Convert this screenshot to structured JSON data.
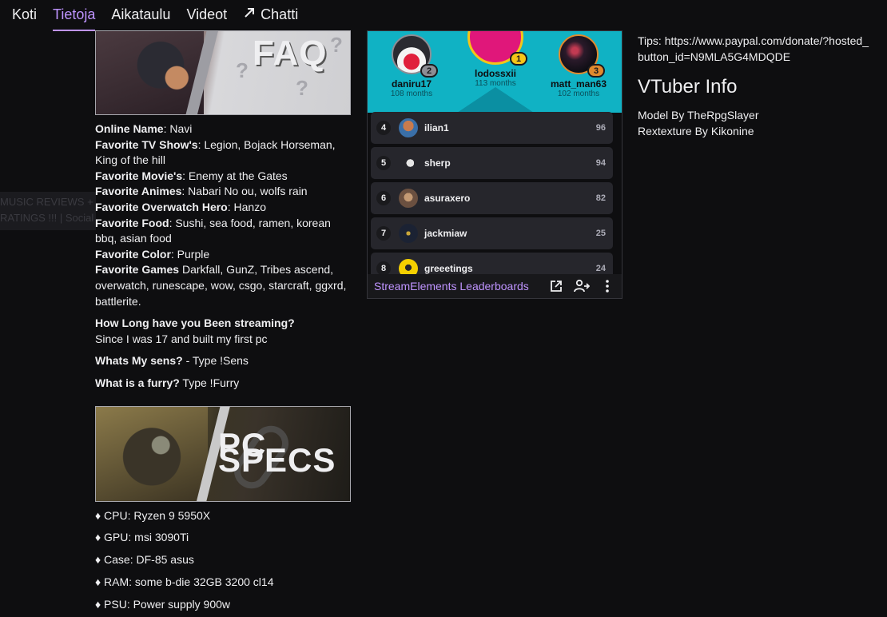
{
  "nav": {
    "tabs": [
      {
        "label": "Koti",
        "active": false
      },
      {
        "label": "Tietoja",
        "active": true
      },
      {
        "label": "Aikataulu",
        "active": false
      },
      {
        "label": "Videot",
        "active": false
      },
      {
        "label": "Chatti",
        "active": false,
        "icon": "external-arrow-icon"
      }
    ]
  },
  "ghost": {
    "line1": "MUSIC REVIEWS +",
    "line2": "RATINGS !!! | Social"
  },
  "faq": {
    "image_text": "FAQ",
    "lines": [
      {
        "label": "Online Name",
        "value": ": Navi"
      },
      {
        "label": "Favorite TV Show's",
        "value": ": Legion, Bojack Horseman, King of the hill"
      },
      {
        "label": "Favorite Movie's",
        "value": ": Enemy at the Gates"
      },
      {
        "label": "Favorite Animes",
        "value": ": Nabari No ou, wolfs rain"
      },
      {
        "label": "Favorite Overwatch Hero",
        "value": ": Hanzo"
      },
      {
        "label": "Favorite Food",
        "value": ": Sushi, sea food, ramen, korean bbq, asian food"
      },
      {
        "label": "Favorite Color",
        "value": ": Purple"
      },
      {
        "label": "Favorite Games",
        "value": " Darkfall, GunZ, Tribes ascend, overwatch, runescape, wow, csgo, starcraft, ggxrd, battlerite."
      }
    ],
    "qa": [
      {
        "q": "How Long have you Been streaming?",
        "a": "Since I was 17 and built my first pc"
      },
      {
        "q": "Whats My sens?",
        "a": " - Type !Sens"
      },
      {
        "q": "What is a furry?",
        "a": " Type !Furry"
      }
    ]
  },
  "pc": {
    "image_text": "PC SPECS",
    "specs": [
      "♦ CPU: Ryzen 9 5950X",
      "♦ GPU: msi 3090Ti",
      "♦ Case: DF-85 asus",
      "♦ RAM: some b-die 32GB 3200 cl14",
      "♦ PSU: Power supply 900w"
    ]
  },
  "leaderboard": {
    "podium": [
      {
        "rank": "2",
        "name": "daniru17",
        "months": "108 months"
      },
      {
        "rank": "1",
        "name": "lodossxii",
        "months": "113 months"
      },
      {
        "rank": "3",
        "name": "matt_man63",
        "months": "102 months"
      }
    ],
    "rows": [
      {
        "rank": "4",
        "name": "ilian1",
        "score": "96"
      },
      {
        "rank": "5",
        "name": "sherp",
        "score": "94"
      },
      {
        "rank": "6",
        "name": "asuraxero",
        "score": "82"
      },
      {
        "rank": "7",
        "name": "jackmiaw",
        "score": "25"
      },
      {
        "rank": "8",
        "name": "greeetings",
        "score": "24"
      }
    ],
    "footer_link": "StreamElements Leaderboards",
    "colors": {
      "gold": "#f5c518",
      "silver": "#8d8d94",
      "bronze": "#e08a2e",
      "teal": "#10b2c4",
      "accent": "#bf94ff"
    }
  },
  "info": {
    "tips": "Tips: https://www.paypal.com/donate/?hosted_button_id=N9MLA5G4MDQDE",
    "vtuber_title": "VTuber Info",
    "model": "Model By TheRpgSlayer",
    "retexture": "Rextexture By Kikonine"
  }
}
